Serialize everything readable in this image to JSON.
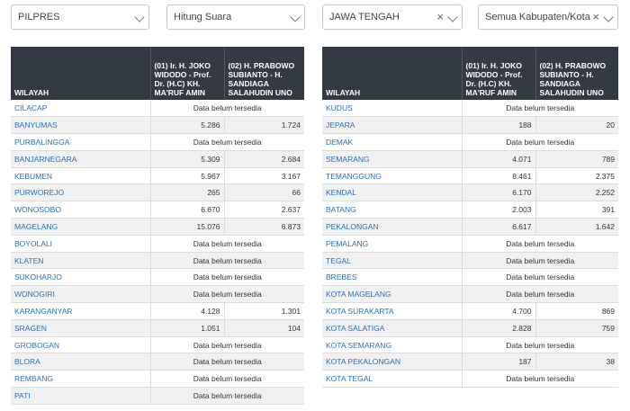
{
  "filters": {
    "election": "PILPRES",
    "mode": "Hitung Suara",
    "province": "JAWA TENGAH",
    "regency": "Semua Kabupaten/Kota",
    "clear_icon": "×"
  },
  "table": {
    "col_region": "WILAYAH",
    "col_candidate1": "(01) Ir. H. JOKO WIDODO - Prof. Dr. (H.C) KH. MA'RUF AMIN",
    "col_candidate2": "(02) H. PRABOWO SUBIANTO - H. SANDIAGA SALAHUDIN UNO",
    "no_data": "Data belum tersedia"
  },
  "left_rows": [
    {
      "region": "CILACAP",
      "c1": null,
      "c2": null
    },
    {
      "region": "BANYUMAS",
      "c1": "5.286",
      "c2": "1.724"
    },
    {
      "region": "PURBALINGGA",
      "c1": null,
      "c2": null
    },
    {
      "region": "BANJARNEGARA",
      "c1": "5.309",
      "c2": "2.684"
    },
    {
      "region": "KEBUMEN",
      "c1": "5.967",
      "c2": "3.167"
    },
    {
      "region": "PURWOREJO",
      "c1": "265",
      "c2": "66"
    },
    {
      "region": "WONOSOBO",
      "c1": "6.670",
      "c2": "2.637"
    },
    {
      "region": "MAGELANG",
      "c1": "15.076",
      "c2": "6.873"
    },
    {
      "region": "BOYOLALI",
      "c1": null,
      "c2": null
    },
    {
      "region": "KLATEN",
      "c1": null,
      "c2": null
    },
    {
      "region": "SUKOHARJO",
      "c1": null,
      "c2": null
    },
    {
      "region": "WONOGIRI",
      "c1": null,
      "c2": null
    },
    {
      "region": "KARANGANYAR",
      "c1": "4.128",
      "c2": "1.301"
    },
    {
      "region": "SRAGEN",
      "c1": "1.051",
      "c2": "104"
    },
    {
      "region": "GROBOGAN",
      "c1": null,
      "c2": null
    },
    {
      "region": "BLORA",
      "c1": null,
      "c2": null
    },
    {
      "region": "REMBANG",
      "c1": null,
      "c2": null
    },
    {
      "region": "PATI",
      "c1": null,
      "c2": null
    }
  ],
  "right_rows": [
    {
      "region": "KUDUS",
      "c1": null,
      "c2": null
    },
    {
      "region": "JEPARA",
      "c1": "188",
      "c2": "20"
    },
    {
      "region": "DEMAK",
      "c1": null,
      "c2": null
    },
    {
      "region": "SEMARANG",
      "c1": "4.071",
      "c2": "789"
    },
    {
      "region": "TEMANGGUNG",
      "c1": "8.461",
      "c2": "2.375"
    },
    {
      "region": "KENDAL",
      "c1": "6.170",
      "c2": "2.252"
    },
    {
      "region": "BATANG",
      "c1": "2.003",
      "c2": "391"
    },
    {
      "region": "PEKALONGAN",
      "c1": "6.617",
      "c2": "1.642"
    },
    {
      "region": "PEMALANG",
      "c1": null,
      "c2": null
    },
    {
      "region": "TEGAL",
      "c1": null,
      "c2": null
    },
    {
      "region": "BREBES",
      "c1": null,
      "c2": null
    },
    {
      "region": "KOTA MAGELANG",
      "c1": null,
      "c2": null
    },
    {
      "region": "KOTA SURAKARTA",
      "c1": "4.700",
      "c2": "869"
    },
    {
      "region": "KOTA SALATIGA",
      "c1": "2.828",
      "c2": "759"
    },
    {
      "region": "KOTA SEMARANG",
      "c1": null,
      "c2": null
    },
    {
      "region": "KOTA PEKALONGAN",
      "c1": "187",
      "c2": "38"
    },
    {
      "region": "KOTA TEGAL",
      "c1": null,
      "c2": null
    }
  ]
}
